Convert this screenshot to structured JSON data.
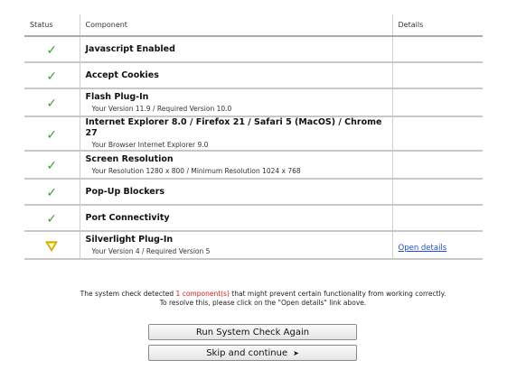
{
  "table": {
    "headers": {
      "status": "Status",
      "component": "Component",
      "details": "Details"
    },
    "rows": [
      {
        "status": "ok",
        "status_icon": "check-icon",
        "name": "Javascript Enabled",
        "detail": "",
        "link": ""
      },
      {
        "status": "ok",
        "status_icon": "check-icon",
        "name": "Accept Cookies",
        "detail": "",
        "link": ""
      },
      {
        "status": "ok",
        "status_icon": "check-icon",
        "name": "Flash Plug-In",
        "detail": "Your Version 11.9 / Required Version 10.0",
        "link": ""
      },
      {
        "status": "ok",
        "status_icon": "check-icon",
        "name": "Internet Explorer 8.0 / Firefox 21 / Safari 5 (MacOS) / Chrome 27",
        "detail": "Your Browser Internet Explorer 9.0",
        "link": ""
      },
      {
        "status": "ok",
        "status_icon": "check-icon",
        "name": "Screen Resolution",
        "detail": "Your Resolution 1280 x 800 / Minimum Resolution 1024 x 768",
        "link": ""
      },
      {
        "status": "ok",
        "status_icon": "check-icon",
        "name": "Pop-Up Blockers",
        "detail": "",
        "link": ""
      },
      {
        "status": "ok",
        "status_icon": "check-icon",
        "name": "Port Connectivity",
        "detail": "",
        "link": ""
      },
      {
        "status": "warning",
        "status_icon": "warning-triangle-icon",
        "name": "Silverlight Plug-In",
        "detail": "Your Version 4 / Required Version 5",
        "link": "Open details"
      }
    ]
  },
  "message": {
    "line1_before": "The system check detected ",
    "line1_highlight": "1 component(s)",
    "line1_after": " that might prevent certain functionality from working correctly.",
    "line2": "To resolve this, please click on the \"Open details\" link above."
  },
  "buttons": {
    "rerun_label": "Run System Check Again",
    "skip_label": "Skip and continue",
    "skip_icon": "arrow-right-icon"
  },
  "colors": {
    "check": "#38a42c",
    "warning_fill": "#f5d000",
    "warning_stroke": "#c9a400",
    "link": "#1a4fd6",
    "highlight": "#d0201e"
  }
}
